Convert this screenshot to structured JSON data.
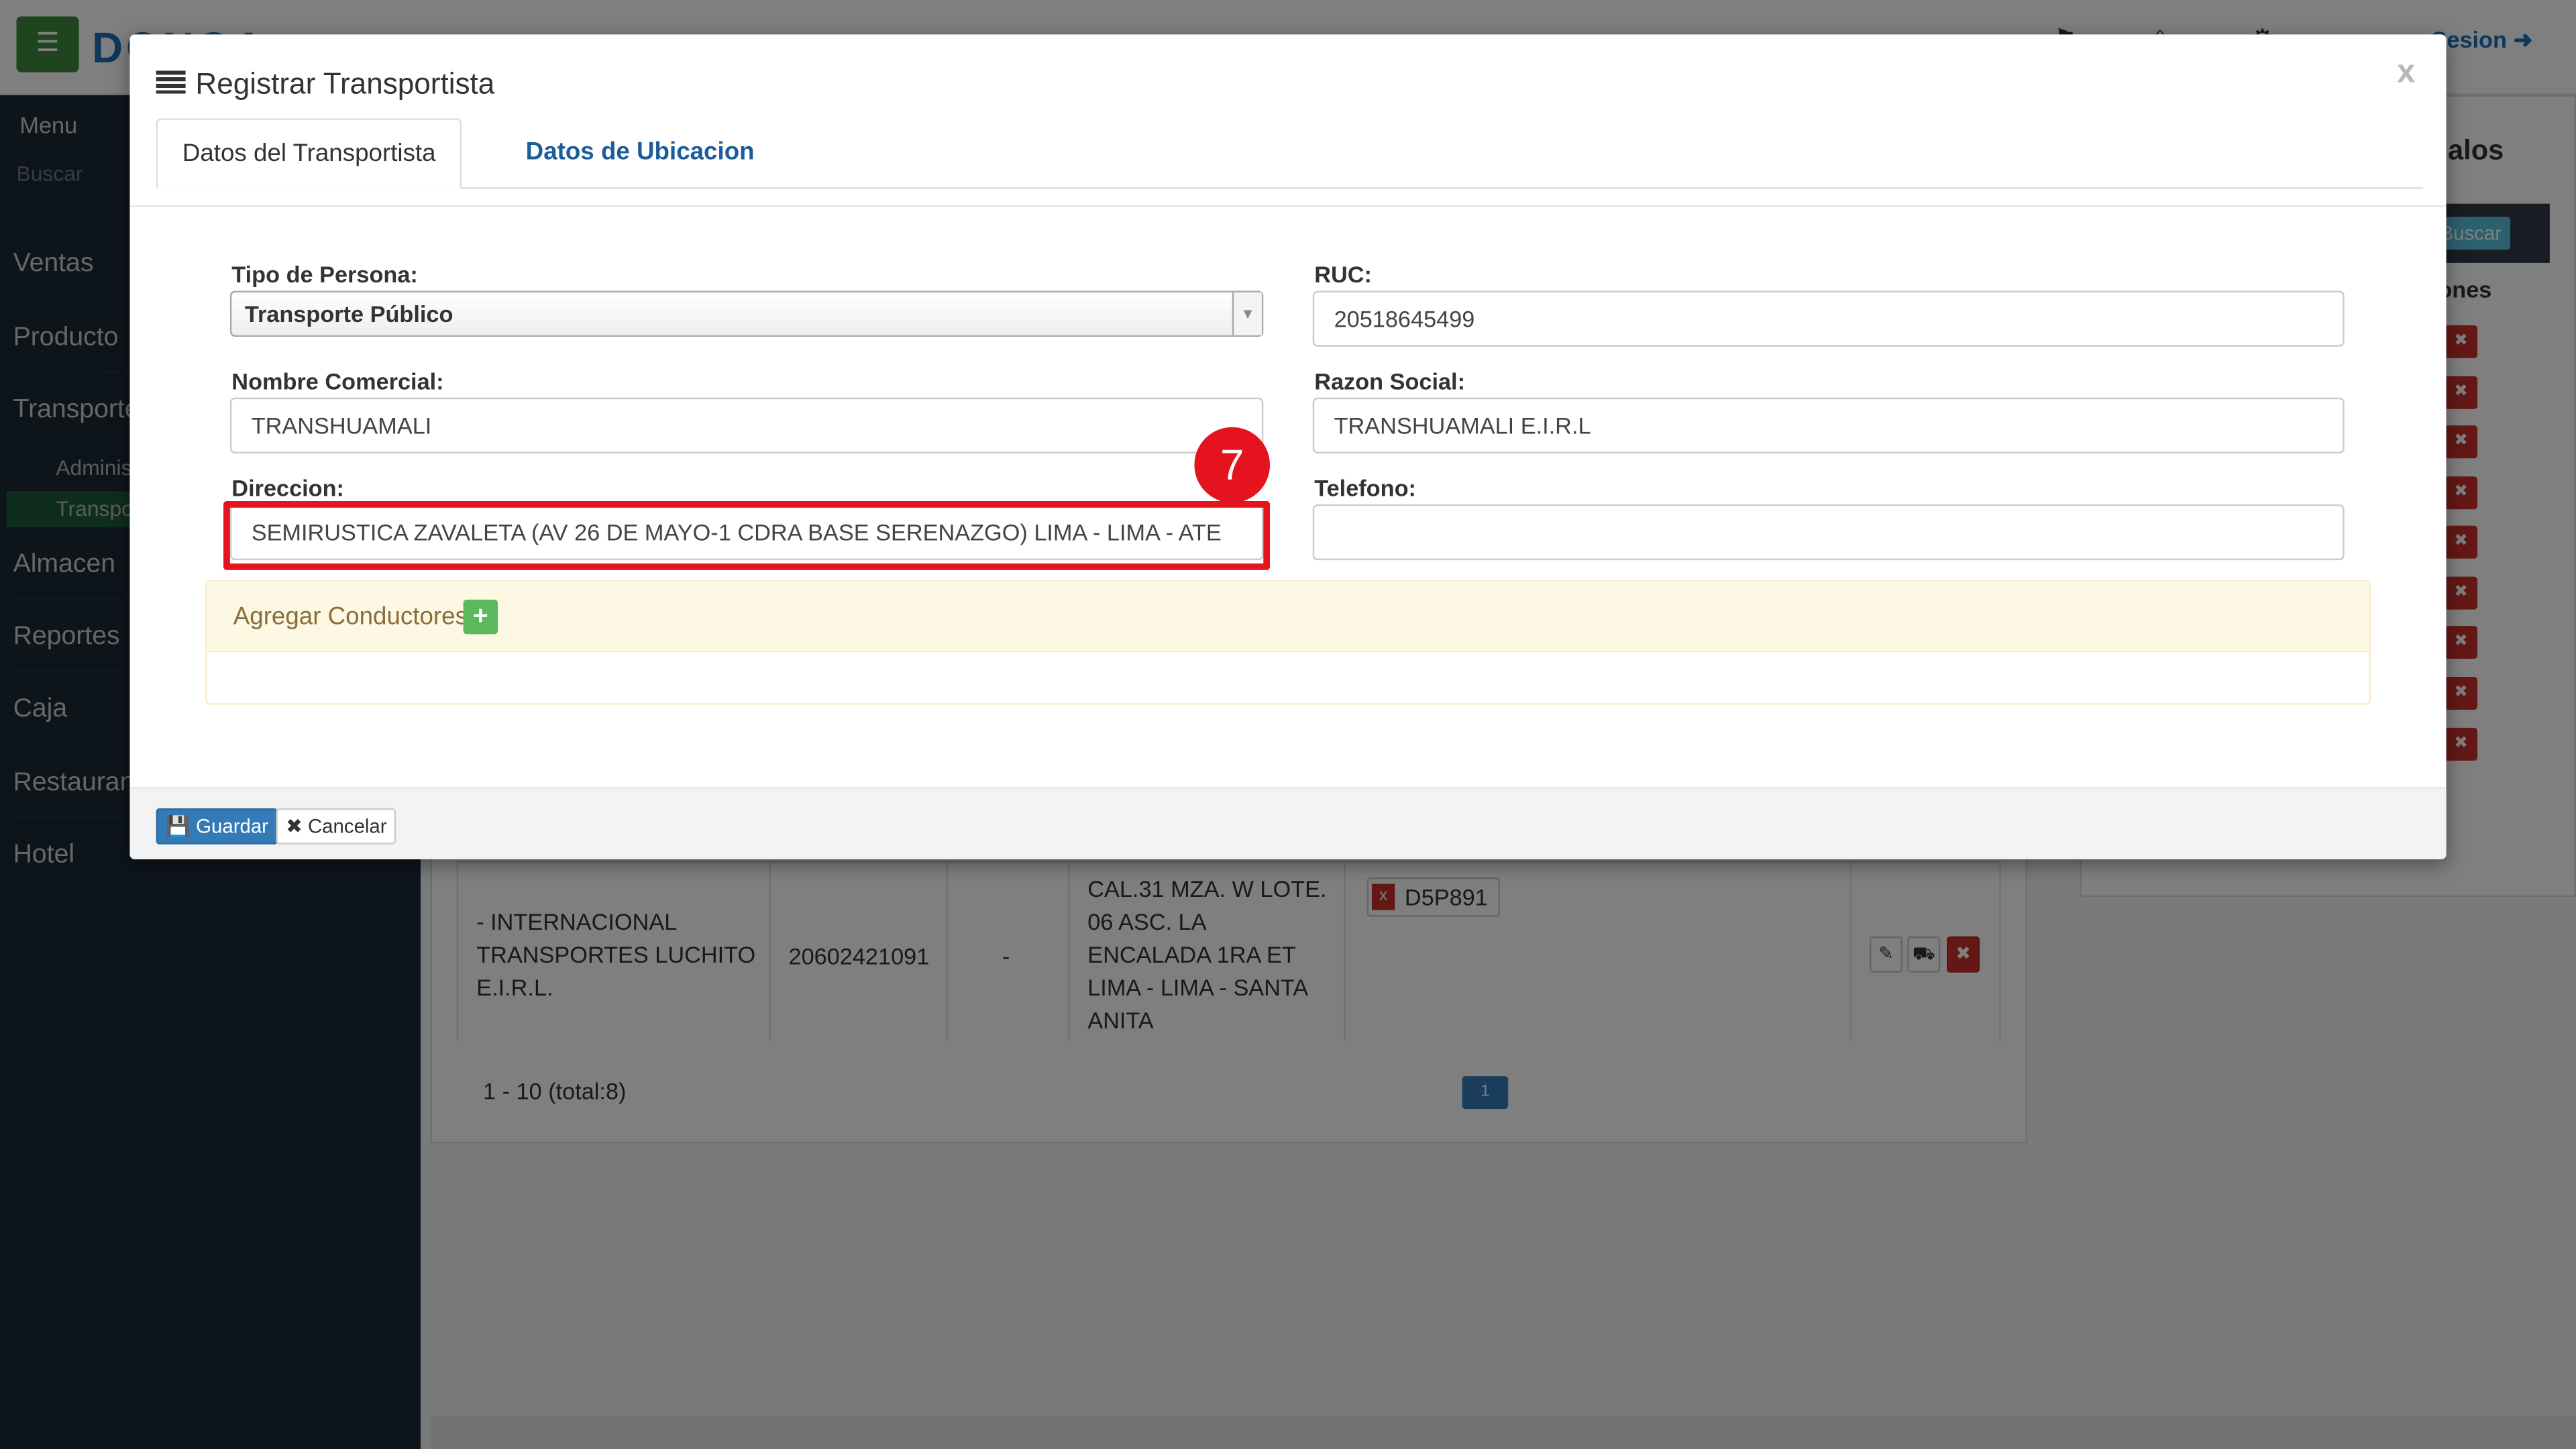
{
  "app": {
    "menu_label": "Menu",
    "search_placeholder": "Buscar",
    "logo_text": "DONGA",
    "sesion_label": "Sesion",
    "sidebar_items": [
      "Ventas",
      "Producto",
      "Transporte",
      "Almacen",
      "Reportes",
      "Caja",
      "Restaurant",
      "Hotel"
    ],
    "sidebar_subitems": [
      "Administrar",
      "Transportistas"
    ]
  },
  "background_table": {
    "row": {
      "nombre": "- INTERNACIONAL TRANSPORTES LUCHITO E.I.R.L.",
      "ruc": "20602421091",
      "telefono": "-",
      "direccion": "CAL.31 MZA. W LOTE. 06 ASC. LA ENCALADA 1RA ET LIMA - LIMA - SANTA ANITA",
      "placa": "D5P891",
      "placa_remove": "x"
    },
    "pager_text": "1 - 10 (total:8)",
    "page_number": "1"
  },
  "right_panel": {
    "title": "alos",
    "search_button": "Buscar",
    "col_header": "ones"
  },
  "modal": {
    "title": "Registrar Transportista",
    "close_label": "x",
    "tabs": [
      "Datos del Transportista",
      "Datos de Ubicacion"
    ],
    "fields": {
      "tipo_persona_label": "Tipo de Persona:",
      "tipo_persona_value": "Transporte Público",
      "ruc_label": "RUC:",
      "ruc_value": "20518645499",
      "nombre_comercial_label": "Nombre Comercial:",
      "nombre_comercial_value": "TRANSHUAMALI",
      "razon_social_label": "Razon Social:",
      "razon_social_value": "TRANSHUAMALI E.I.R.L",
      "direccion_label": "Direccion:",
      "direccion_value": "SEMIRUSTICA ZAVALETA (AV 26 DE MAYO-1 CDRA BASE SERENAZGO) LIMA - LIMA - ATE",
      "telefono_label": "Telefono:",
      "telefono_value": ""
    },
    "step_marker": "7",
    "conductores_label": "Agregar Conductores",
    "add_symbol": "+",
    "buttons": {
      "guardar": "Guardar",
      "cancelar": "Cancelar"
    }
  },
  "colors": {
    "highlight": "#e4131d",
    "primary": "#337ab7",
    "success": "#5cb85c",
    "link": "#1c5d99"
  }
}
